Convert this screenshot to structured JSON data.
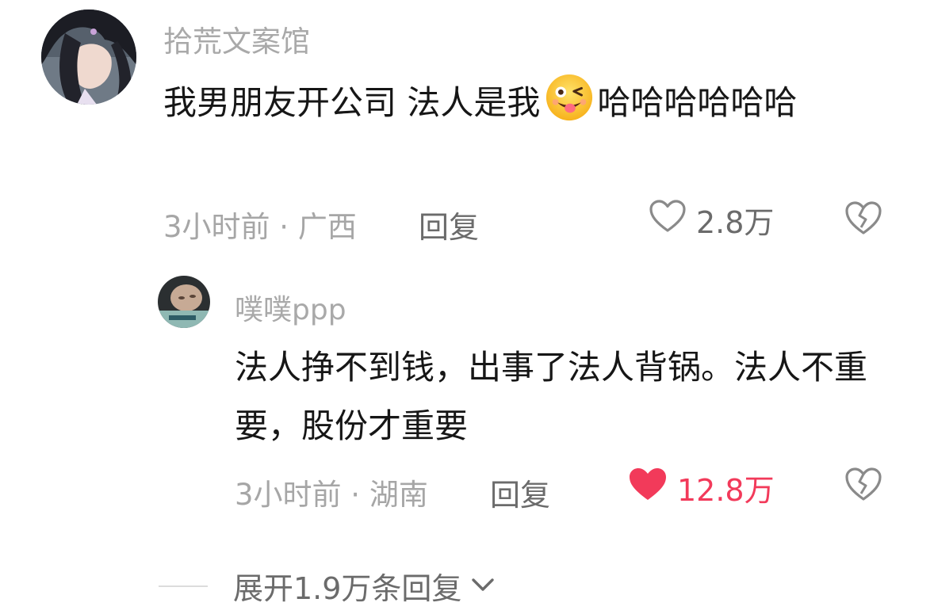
{
  "comments": [
    {
      "username": "拾荒文案馆",
      "content_before_emoji": "我男朋友开公司 法人是我",
      "emoji": "wink-tongue-emoji",
      "content_after_emoji": "哈哈哈哈哈哈",
      "meta": "3小时前 · 广西",
      "reply_label": "回复",
      "likes": "2.8万",
      "liked": false
    },
    {
      "username": "噗噗ppp",
      "content": "法人挣不到钱，出事了法人背锅。法人不重要，股份才重要",
      "meta": "3小时前 · 湖南",
      "reply_label": "回复",
      "likes": "12.8万",
      "liked": true
    }
  ],
  "expand_replies": {
    "label": "展开1.9万条回复",
    "icon": "chevron-down-icon"
  },
  "colors": {
    "liked_red": "#f23a5a",
    "gray_text": "#a6a6a6",
    "reply_text": "#6b6b6b"
  }
}
